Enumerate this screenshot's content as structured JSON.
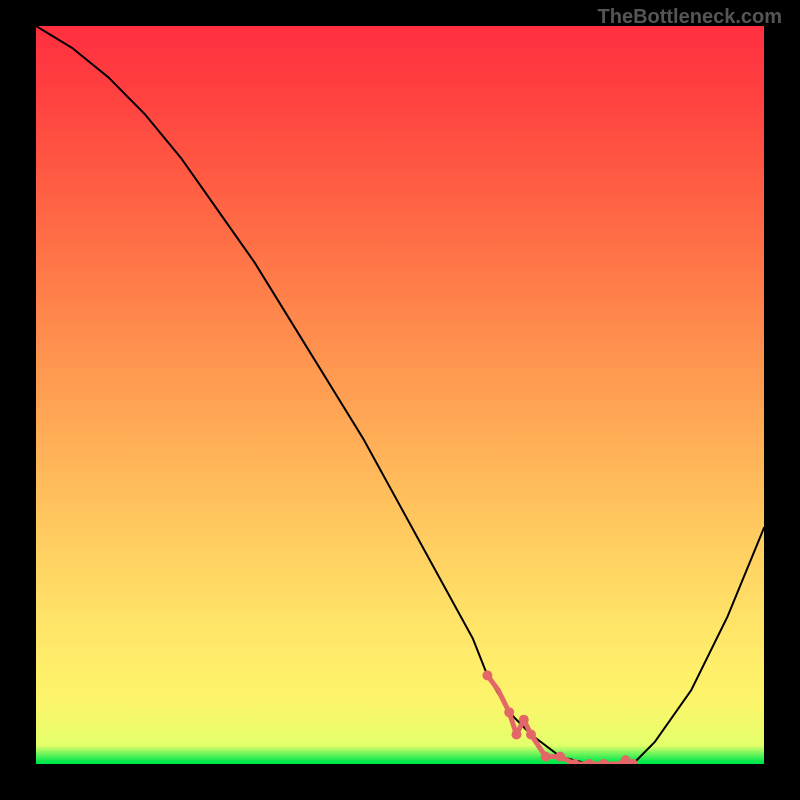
{
  "watermark": "TheBottleneck.com",
  "chart_data": {
    "type": "line",
    "title": "",
    "xlabel": "",
    "ylabel": "",
    "xlim": [
      0,
      100
    ],
    "ylim": [
      0,
      100
    ],
    "series": [
      {
        "name": "bottleneck-curve",
        "x": [
          0,
          5,
          10,
          15,
          20,
          25,
          30,
          35,
          40,
          45,
          50,
          55,
          60,
          62,
          65,
          68,
          72,
          76,
          80,
          82,
          85,
          90,
          95,
          100
        ],
        "y": [
          100,
          97,
          93,
          88,
          82,
          75,
          68,
          60,
          52,
          44,
          35,
          26,
          17,
          12,
          7,
          4,
          1,
          0,
          0,
          0,
          3,
          10,
          20,
          32
        ],
        "color": "#000000"
      },
      {
        "name": "highlight-flat-segment",
        "x": [
          62,
          63.5,
          65,
          66,
          67,
          68,
          70,
          72,
          74,
          76,
          78,
          80,
          81,
          82
        ],
        "y": [
          12,
          10,
          7,
          4,
          6,
          4,
          1,
          1,
          0,
          0,
          0,
          0,
          0.5,
          0
        ],
        "color": "#e36767"
      }
    ],
    "highlight_dots": {
      "name": "highlight-dots",
      "color": "#e36767",
      "points": [
        {
          "x": 62,
          "y": 12
        },
        {
          "x": 65,
          "y": 7
        },
        {
          "x": 66,
          "y": 4
        },
        {
          "x": 67,
          "y": 6
        },
        {
          "x": 68,
          "y": 4
        },
        {
          "x": 70,
          "y": 1
        },
        {
          "x": 72,
          "y": 1
        },
        {
          "x": 74,
          "y": 0
        },
        {
          "x": 76,
          "y": 0
        },
        {
          "x": 78,
          "y": 0
        },
        {
          "x": 81,
          "y": 0.5
        },
        {
          "x": 82,
          "y": 0
        }
      ]
    }
  }
}
